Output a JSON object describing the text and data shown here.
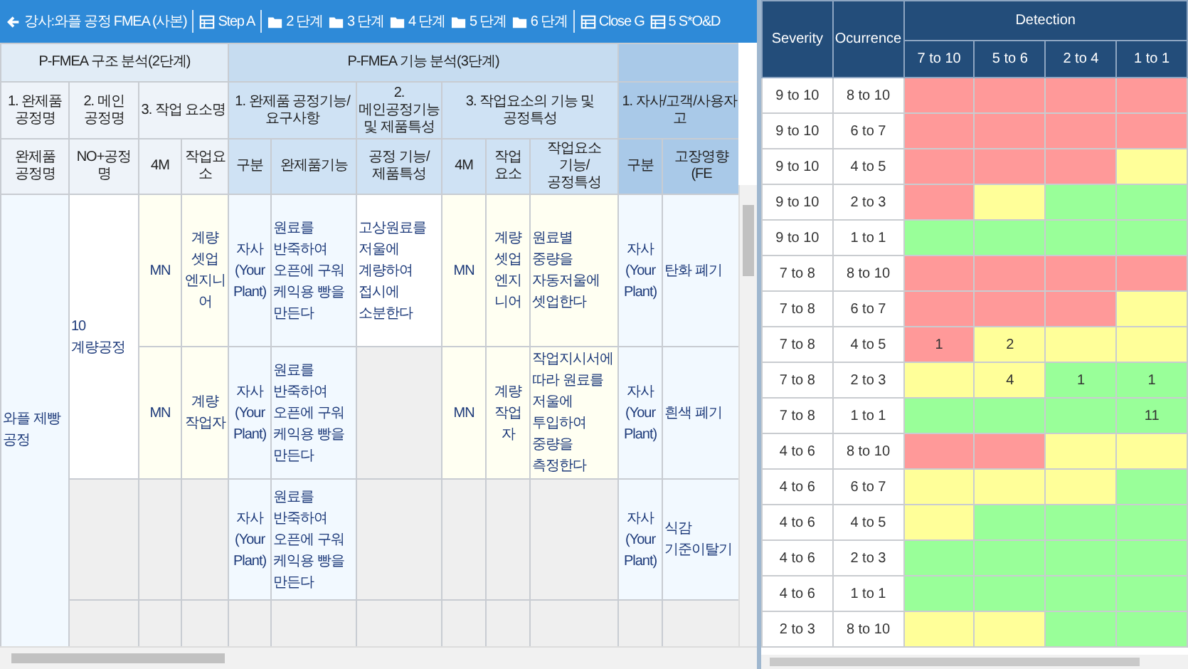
{
  "toolbar": {
    "groups": [
      [
        {
          "kind": "back",
          "label": "강사:와플 공정 FMEA (사본)"
        }
      ],
      [
        {
          "kind": "table",
          "label": "Step A"
        }
      ],
      [
        {
          "kind": "folder",
          "label": "2 단계"
        },
        {
          "kind": "folder",
          "label": "3 단계"
        },
        {
          "kind": "folder",
          "label": "4 단계"
        },
        {
          "kind": "folder",
          "label": "5 단계"
        },
        {
          "kind": "folder",
          "label": "6 단계"
        }
      ],
      [
        {
          "kind": "table",
          "label": "Close G"
        },
        {
          "kind": "table",
          "label": "5 S*O&D"
        }
      ]
    ]
  },
  "fmea_table": {
    "group_headers": [
      "P-FMEA 구조 분석(2단계)",
      "P-FMEA 기능 분석(3단계)"
    ],
    "sub_headers": [
      "1. 완제품 공정명",
      "2. 메인 공정명",
      "3. 작업 요소명",
      "1. 완제품 공정기능/요구사항",
      "2. 메인공정기능 및 제품특성",
      "3. 작업요소의 기능 및 공정특성",
      "1. 자사/고객/사용자 고"
    ],
    "columns": [
      "완제품 공정명",
      "NO+공정명",
      "4M",
      "작업요소",
      "구분",
      "완제품기능",
      "공정 기능/제품특성",
      "4M",
      "작업요소",
      "작업요소 기능/공정특성",
      "구분",
      "고장영향(FE"
    ],
    "product_process": "와플 제빵 공정",
    "main_processes": [
      {
        "label": "10 계량공정",
        "rows": [
          [
            "MN",
            "계량 셋업 엔지니어",
            "자사 (Your Plant)",
            "원료를 반죽하여 오픈에 구워 케익용 빵을 만든다",
            "고상원료를 저울에 계량하여 접시에 소분한다",
            "MN",
            "계량 셋업 엔지니어",
            "원료별 중량을 자동저울에 셋업한다",
            "자사 (Your Plant)",
            "탄화 폐기"
          ],
          [
            "MN",
            "계량 작업자",
            "자사 (Your Plant)",
            "원료를 반죽하여 오픈에 구워 케익용 빵을 만든다",
            null,
            "MN",
            "계량 작업자",
            "작업지시서에 따라 원료를 저울에 투입하여 중량을 측정한다",
            "자사 (Your Plant)",
            "흰색 폐기"
          ]
        ]
      },
      {
        "rows": [
          [
            null,
            null,
            "자사 (Your Plant)",
            "원료를 반죽하여 오픈에 구워 케익용 빵을 만든다",
            null,
            null,
            null,
            null,
            "자사 (Your Plant)",
            "식감 기준이탈기"
          ]
        ]
      },
      {
        "rows": [
          [
            null,
            null,
            null,
            null,
            null,
            null,
            null,
            null,
            null,
            null
          ]
        ]
      }
    ]
  },
  "risk_matrix": {
    "columns": [
      "Severity",
      "Ocurrence"
    ],
    "detection_label": "Detection",
    "detection_columns": [
      "7 to 10",
      "5 to 6",
      "2 to 4",
      "1 to 1"
    ],
    "rows": [
      {
        "severity": "9 to 10",
        "occurrence": "8 to 10",
        "cells": [
          {
            "color": "#ff9999"
          },
          {
            "color": "#ff9999"
          },
          {
            "color": "#ff9999"
          },
          {
            "color": "#ff9999"
          }
        ]
      },
      {
        "severity": "9 to 10",
        "occurrence": "6 to 7",
        "cells": [
          {
            "color": "#ff9999"
          },
          {
            "color": "#ff9999"
          },
          {
            "color": "#ff9999"
          },
          {
            "color": "#ff9999"
          }
        ]
      },
      {
        "severity": "9 to 10",
        "occurrence": "4 to 5",
        "cells": [
          {
            "color": "#ff9999"
          },
          {
            "color": "#ff9999"
          },
          {
            "color": "#ff9999"
          },
          {
            "color": "#ffff99"
          }
        ]
      },
      {
        "severity": "9 to 10",
        "occurrence": "2 to 3",
        "cells": [
          {
            "color": "#ff9999"
          },
          {
            "color": "#ffff99"
          },
          {
            "color": "#99ff99"
          },
          {
            "color": "#99ff99"
          }
        ]
      },
      {
        "severity": "9 to 10",
        "occurrence": "1 to 1",
        "cells": [
          {
            "color": "#99ff99"
          },
          {
            "color": "#99ff99"
          },
          {
            "color": "#99ff99"
          },
          {
            "color": "#99ff99"
          }
        ]
      },
      {
        "severity": "7 to 8",
        "occurrence": "8 to 10",
        "cells": [
          {
            "color": "#ff9999"
          },
          {
            "color": "#ff9999"
          },
          {
            "color": "#ff9999"
          },
          {
            "color": "#ff9999"
          }
        ]
      },
      {
        "severity": "7 to 8",
        "occurrence": "6 to 7",
        "cells": [
          {
            "color": "#ff9999"
          },
          {
            "color": "#ff9999"
          },
          {
            "color": "#ff9999"
          },
          {
            "color": "#ffff99"
          }
        ]
      },
      {
        "severity": "7 to 8",
        "occurrence": "4 to 5",
        "cells": [
          {
            "color": "#ff9999",
            "count": "1"
          },
          {
            "color": "#ffff99",
            "count": "2"
          },
          {
            "color": "#ffff99"
          },
          {
            "color": "#ffff99"
          }
        ]
      },
      {
        "severity": "7 to 8",
        "occurrence": "2 to 3",
        "cells": [
          {
            "color": "#ffff99"
          },
          {
            "color": "#ffff99",
            "count": "4"
          },
          {
            "color": "#99ff99",
            "count": "1"
          },
          {
            "color": "#99ff99",
            "count": "1"
          }
        ]
      },
      {
        "severity": "7 to 8",
        "occurrence": "1 to 1",
        "cells": [
          {
            "color": "#99ff99"
          },
          {
            "color": "#99ff99"
          },
          {
            "color": "#99ff99"
          },
          {
            "color": "#99ff99",
            "count": "11"
          }
        ]
      },
      {
        "severity": "4 to 6",
        "occurrence": "8 to 10",
        "cells": [
          {
            "color": "#ff9999"
          },
          {
            "color": "#ff9999"
          },
          {
            "color": "#ffff99"
          },
          {
            "color": "#ffff99"
          }
        ]
      },
      {
        "severity": "4 to 6",
        "occurrence": "6 to 7",
        "cells": [
          {
            "color": "#ffff99"
          },
          {
            "color": "#ffff99"
          },
          {
            "color": "#ffff99"
          },
          {
            "color": "#99ff99"
          }
        ]
      },
      {
        "severity": "4 to 6",
        "occurrence": "4 to 5",
        "cells": [
          {
            "color": "#ffff99"
          },
          {
            "color": "#99ff99"
          },
          {
            "color": "#99ff99"
          },
          {
            "color": "#99ff99"
          }
        ]
      },
      {
        "severity": "4 to 6",
        "occurrence": "2 to 3",
        "cells": [
          {
            "color": "#99ff99"
          },
          {
            "color": "#99ff99"
          },
          {
            "color": "#99ff99"
          },
          {
            "color": "#99ff99"
          }
        ]
      },
      {
        "severity": "4 to 6",
        "occurrence": "1 to 1",
        "cells": [
          {
            "color": "#99ff99"
          },
          {
            "color": "#99ff99"
          },
          {
            "color": "#99ff99"
          },
          {
            "color": "#99ff99"
          }
        ]
      },
      {
        "severity": "2 to 3",
        "occurrence": "8 to 10",
        "cells": [
          {
            "color": "#ffff99"
          },
          {
            "color": "#ffff99"
          },
          {
            "color": "#99ff99"
          },
          {
            "color": "#99ff99"
          }
        ]
      }
    ]
  }
}
